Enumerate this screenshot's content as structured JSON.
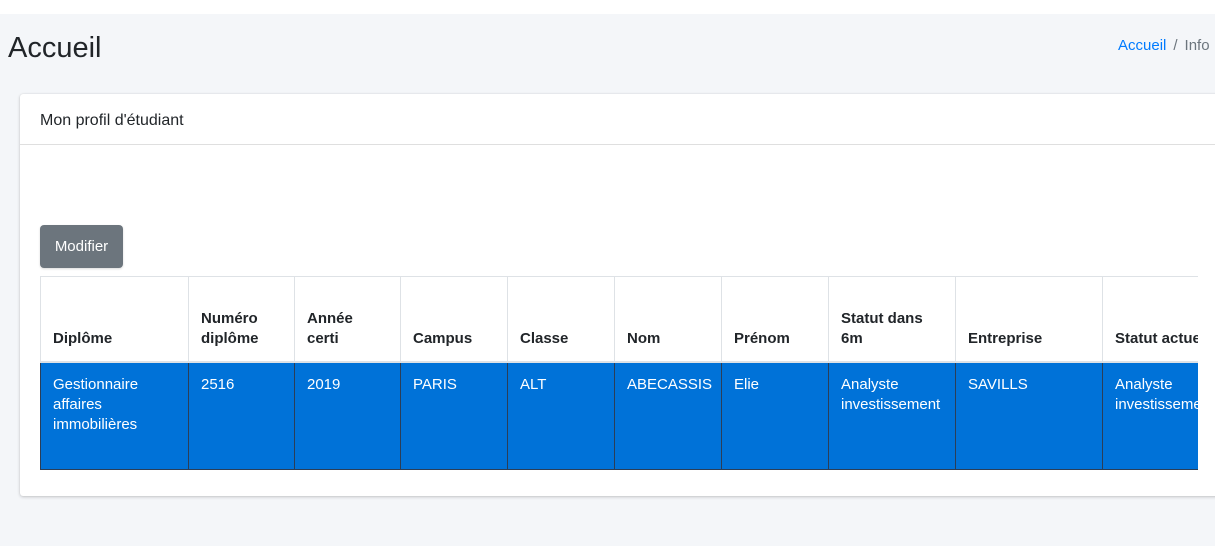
{
  "header": {
    "title": "Accueil",
    "breadcrumb": {
      "home": "Accueil",
      "separator": "/",
      "current": "Info"
    }
  },
  "card": {
    "title": "Mon profil d'étudiant",
    "modify_button": "Modifier"
  },
  "table": {
    "columns": [
      "Diplôme",
      "Numéro diplôme",
      "Année certi",
      "Campus",
      "Classe",
      "Nom",
      "Prénom",
      "Statut dans 6m",
      "Entreprise",
      "Statut actuel"
    ],
    "rows": [
      [
        "Gestionnaire affaires immobilières",
        "2516",
        "2019",
        "PARIS",
        "ALT",
        "ABECASSIS",
        "Elie",
        "Analyste investissement",
        "SAVILLS",
        "Analyste investissement"
      ]
    ]
  },
  "colors": {
    "selected_row": "#0072d8",
    "button": "#6c757d",
    "link": "#007bff"
  }
}
